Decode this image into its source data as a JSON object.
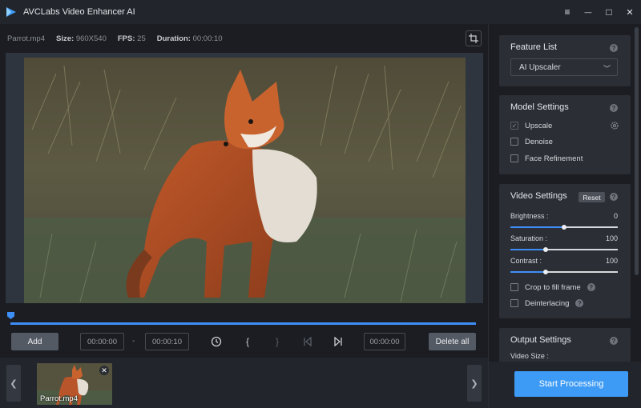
{
  "app": {
    "title": "AVCLabs Video Enhancer AI"
  },
  "window_controls": {
    "menu": "≡",
    "minimize": "—",
    "maximize": "□",
    "close": "✕"
  },
  "file_info": {
    "filename": "Parrot.mp4",
    "size_label": "Size:",
    "size_value": "960X540",
    "fps_label": "FPS:",
    "fps_value": "25",
    "duration_label": "Duration:",
    "duration_value": "00:00:10"
  },
  "controls": {
    "add_label": "Add",
    "start_time": "00:00:00",
    "dash": "-",
    "end_time": "00:00:10",
    "current_time": "00:00:00",
    "delete_all_label": "Delete all",
    "mark_in": "{",
    "mark_out": "}"
  },
  "thumbnails": [
    {
      "label": "Parrot.mp4"
    }
  ],
  "timeline": {
    "progress": 0
  },
  "feature_list": {
    "title": "Feature List",
    "selected": "AI Upscaler"
  },
  "model_settings": {
    "title": "Model Settings",
    "options": [
      {
        "label": "Upscale",
        "checked": true
      },
      {
        "label": "Denoise",
        "checked": false
      },
      {
        "label": "Face Refinement",
        "checked": false
      }
    ]
  },
  "video_settings": {
    "title": "Video Settings",
    "reset_label": "Reset",
    "brightness": {
      "label": "Brightness :",
      "value": "0",
      "level": 0.5
    },
    "saturation": {
      "label": "Saturation :",
      "value": "100",
      "level": 0.33
    },
    "contrast": {
      "label": "Contrast :",
      "value": "100",
      "level": 0.33
    },
    "crop_label": "Crop to fill frame",
    "deinterlace_label": "Deinterlacing"
  },
  "output_settings": {
    "title": "Output Settings",
    "video_size_label": "Video Size :"
  },
  "start_processing_label": "Start Processing",
  "colors": {
    "accent": "#3e8ef7",
    "button": "#3e9bf5",
    "panel": "#2b2e35",
    "background": "#1b1d22"
  }
}
